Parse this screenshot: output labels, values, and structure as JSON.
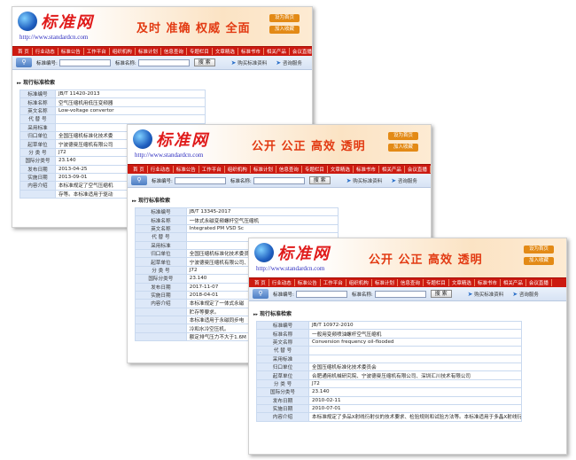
{
  "cards": [
    {
      "logo_text": "标准网",
      "logo_url": "http://www.standardcn.com",
      "slogan": "及时 准确 权威 全面",
      "btn_home": "设为首页",
      "btn_fav": "加入收藏",
      "nav": [
        "首 页",
        "行业动态",
        "标准公告",
        "工作平台",
        "组织机构",
        "标准计划",
        "信息查询",
        "专题栏目",
        "文章精选",
        "标准书市",
        "相关产品",
        "会议直播"
      ],
      "search_label_no": "标准编号:",
      "search_label_name": "标准名称:",
      "search_btn": "搜 索",
      "buy_link": "购买标准资料",
      "consult_link": "咨询服务",
      "section_title": "现行标准检索",
      "fields": [
        {
          "k": "标准编号",
          "v": "JB/T 11420-2013"
        },
        {
          "k": "标准名称",
          "v": "空气压缩机用低压变频器"
        },
        {
          "k": "英文名称",
          "v": "Low-voltage convertor"
        },
        {
          "k": "代 替 号",
          "v": ""
        },
        {
          "k": "采用标准",
          "v": ""
        },
        {
          "k": "归口单位",
          "v": "全国压缩机标准化技术委"
        },
        {
          "k": "起草单位",
          "v": "宁波德曼压缩机有限公司"
        },
        {
          "k": "分 类 号",
          "v": "J72"
        },
        {
          "k": "国际分类号",
          "v": "23.140"
        },
        {
          "k": "发布日期",
          "v": "2013-04-25"
        },
        {
          "k": "实施日期",
          "v": "2013-09-01"
        },
        {
          "k": "内容介绍",
          "v": "本标准规定了空气压缩机"
        },
        {
          "k": "",
          "v": "存等。本标准适用于驱动"
        }
      ]
    },
    {
      "logo_text": "标准网",
      "logo_url": "http://www.standardcn.com",
      "slogan": "公开 公正 高效 透明",
      "btn_home": "设为首页",
      "btn_fav": "加入收藏",
      "nav": [
        "首 页",
        "行业动态",
        "标准公告",
        "工作平台",
        "组织机构",
        "标准计划",
        "信息查询",
        "专题栏目",
        "文章精选",
        "标准书市",
        "相关产品",
        "会议直播"
      ],
      "search_label_no": "标准编号:",
      "search_label_name": "标准名称:",
      "search_btn": "搜 索",
      "buy_link": "购买标准资料",
      "consult_link": "咨询服务",
      "section_title": "现行标准检索",
      "fields": [
        {
          "k": "标准编号",
          "v": "JB/T 13345-2017"
        },
        {
          "k": "标准名称",
          "v": "一体式永磁变频螺杆空气压缩机"
        },
        {
          "k": "英文名称",
          "v": "Integrated PM VSD Sc"
        },
        {
          "k": "代 替 号",
          "v": ""
        },
        {
          "k": "采用标准",
          "v": ""
        },
        {
          "k": "归口单位",
          "v": "全国压缩机标准化技术委员"
        },
        {
          "k": "起草单位",
          "v": "宁波德曼压缩机有限公司、"
        },
        {
          "k": "分 类 号",
          "v": "J72"
        },
        {
          "k": "国际分类号",
          "v": "23.140"
        },
        {
          "k": "发布日期",
          "v": "2017-11-07"
        },
        {
          "k": "实施日期",
          "v": "2018-04-01"
        },
        {
          "k": "内容介绍",
          "v": "本标准规定了一体式永磁"
        },
        {
          "k": "",
          "v": "贮存等要求。"
        },
        {
          "k": "",
          "v": "本标准适用于永磁同步电"
        },
        {
          "k": "",
          "v": "冷和水冷空压机。"
        },
        {
          "k": "",
          "v": "额定排气压力不大于1.6M"
        }
      ]
    },
    {
      "logo_text": "标准网",
      "logo_url": "http://www.standardcn.com",
      "slogan": "公开 公正 高效 透明",
      "btn_home": "设为首页",
      "btn_fav": "加入收藏",
      "nav": [
        "首 页",
        "行业动态",
        "标准公告",
        "工作平台",
        "组织机构",
        "标准计划",
        "信息查询",
        "专题栏目",
        "文章精选",
        "标准书市",
        "相关产品",
        "会议直播"
      ],
      "search_label_no": "标准编号:",
      "search_label_name": "标准名称:",
      "search_btn": "搜 索",
      "buy_link": "购买标准资料",
      "consult_link": "咨询服务",
      "section_title": "现行标准检索",
      "fields": [
        {
          "k": "标准编号",
          "v": "JB/T 10972-2010"
        },
        {
          "k": "标准名称",
          "v": "一般用变频喷油螺杆空气压缩机"
        },
        {
          "k": "英文名称",
          "v": "Conversion frequency oil-flooded"
        },
        {
          "k": "代 替 号",
          "v": ""
        },
        {
          "k": "采用标准",
          "v": ""
        },
        {
          "k": "归口单位",
          "v": "全国压缩机标准化技术委员会"
        },
        {
          "k": "起草单位",
          "v": "合肥通用机械研究院、宁波德曼压缩机有限公司、深圳汇川技术有限公司"
        },
        {
          "k": "分 类 号",
          "v": "J72"
        },
        {
          "k": "国际分类号",
          "v": "23.140"
        },
        {
          "k": "发布日期",
          "v": "2010-02-11"
        },
        {
          "k": "实施日期",
          "v": "2010-07-01"
        },
        {
          "k": "内容介绍",
          "v": "本标准规定了多品X射线衍射仪的技术要求、检验规则和试验方法等。本标准适用于多晶X射线衍射仪。"
        }
      ]
    }
  ]
}
